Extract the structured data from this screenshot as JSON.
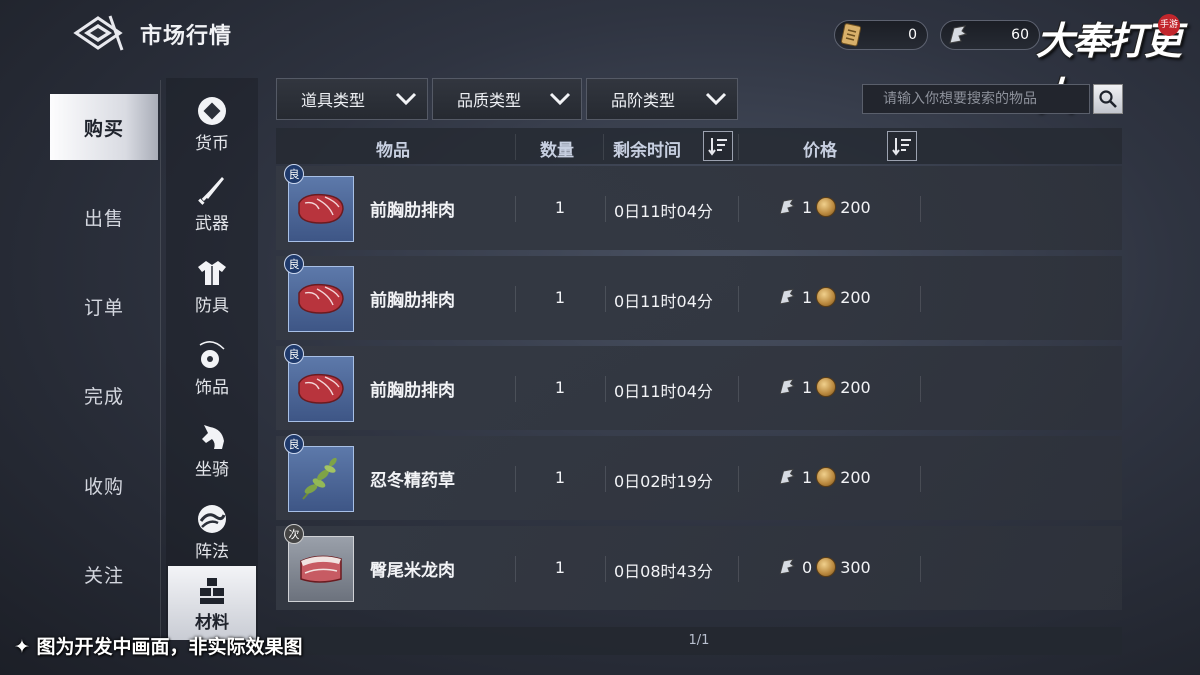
{
  "header": {
    "title": "市场行情"
  },
  "currencies": [
    {
      "icon": "ticket-icon",
      "value": "0"
    },
    {
      "icon": "silver-icon",
      "value": "60"
    }
  ],
  "logo": {
    "text": "大奉打更人",
    "badge": "手游"
  },
  "nav": [
    {
      "label": "购买",
      "active": true
    },
    {
      "label": "出售"
    },
    {
      "label": "订单"
    },
    {
      "label": "完成"
    },
    {
      "label": "收购"
    },
    {
      "label": "关注"
    }
  ],
  "categories": [
    {
      "label": "货币",
      "icon": "currency-icon"
    },
    {
      "label": "武器",
      "icon": "sword-icon"
    },
    {
      "label": "防具",
      "icon": "armor-icon"
    },
    {
      "label": "饰品",
      "icon": "accessory-icon"
    },
    {
      "label": "坐骑",
      "icon": "horse-icon"
    },
    {
      "label": "阵法",
      "icon": "formation-icon"
    },
    {
      "label": "材料",
      "icon": "material-icon",
      "active": true
    }
  ],
  "filters": [
    {
      "label": "道具类型"
    },
    {
      "label": "品质类型"
    },
    {
      "label": "品阶类型"
    }
  ],
  "search": {
    "placeholder": "请输入你想要搜索的物品"
  },
  "table": {
    "headers": {
      "item": "物品",
      "qty": "数量",
      "time": "剩余时间",
      "price": "价格"
    },
    "rows": [
      {
        "quality": "良",
        "quality_color": "#1f3a6c",
        "name": "前胸肋排肉",
        "icon": "meat-icon",
        "qty": "1",
        "time": "0日11时04分",
        "silver": "1",
        "copper": "200"
      },
      {
        "quality": "良",
        "quality_color": "#1f3a6c",
        "name": "前胸肋排肉",
        "icon": "meat-icon",
        "qty": "1",
        "time": "0日11时04分",
        "silver": "1",
        "copper": "200"
      },
      {
        "quality": "良",
        "quality_color": "#1f3a6c",
        "name": "前胸肋排肉",
        "icon": "meat-icon",
        "qty": "1",
        "time": "0日11时04分",
        "silver": "1",
        "copper": "200"
      },
      {
        "quality": "良",
        "quality_color": "#1f3a6c",
        "name": "忍冬精药草",
        "icon": "herb-icon",
        "qty": "1",
        "time": "0日02时19分",
        "silver": "1",
        "copper": "200"
      },
      {
        "quality": "次",
        "quality_color": "#444444",
        "name": "臀尾米龙肉",
        "icon": "rump-meat-icon",
        "qty": "1",
        "time": "0日08时43分",
        "silver": "0",
        "copper": "300"
      }
    ]
  },
  "pager": {
    "text": "1/1"
  },
  "footnote": "✦ 图为开发中画面，非实际效果图"
}
